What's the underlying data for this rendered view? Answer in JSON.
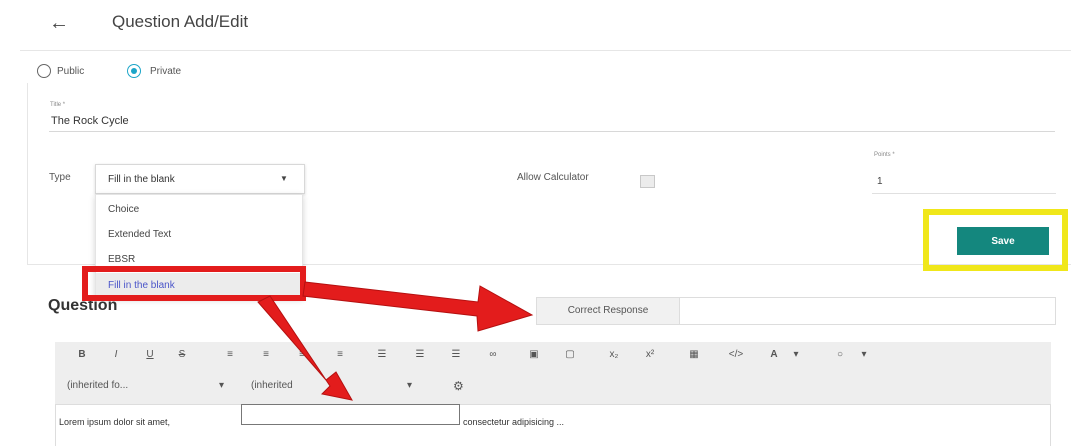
{
  "header": {
    "back_icon": "arrow-left-icon",
    "back_glyph": "←",
    "title": "Question Add/Edit"
  },
  "visibility": {
    "options": [
      "Public",
      "Private"
    ],
    "selected": "Private"
  },
  "form": {
    "title_label": "Title *",
    "title_value": "The Rock Cycle",
    "type_label": "Type",
    "type_value": "Fill in the blank",
    "type_options": [
      "Choice",
      "Extended Text",
      "EBSR",
      "Fill in the blank"
    ],
    "allow_calculator_label": "Allow Calculator",
    "allow_calculator_checked": false,
    "points_label": "Points *",
    "points_value": "1"
  },
  "save_label": "Save",
  "question": {
    "heading": "Question",
    "correct_response_label": "Correct Response",
    "correct_response_value": ""
  },
  "toolbar": {
    "buttons": [
      "B",
      "I",
      "U",
      "S",
      "≡",
      "≡",
      "≡",
      "≡",
      "☰",
      "☰",
      "☰",
      "∞",
      "▣",
      "▢",
      "x₂",
      "x²",
      "▦",
      "</>",
      "A",
      "▾",
      "○",
      "▾"
    ],
    "button_icons": [
      "bold-icon",
      "italic-icon",
      "underline-icon",
      "strikethrough-icon",
      "align-left-icon",
      "align-center-icon",
      "align-right-icon",
      "align-justify-icon",
      "bullet-list-icon",
      "numbered-list-icon",
      "indent-icon",
      "link-icon",
      "image-icon",
      "file-icon",
      "subscript-icon",
      "superscript-icon",
      "table-icon",
      "code-icon",
      "font-color-icon",
      "font-color-caret-icon",
      "highlight-icon",
      "highlight-caret-icon"
    ],
    "font_family": "(inherited fo...",
    "font_size": "(inherited",
    "caret": "▾",
    "settings_icon": "gear-icon",
    "settings_glyph": "⚙"
  },
  "editor": {
    "text_before": "Lorem ipsum dolor sit amet,",
    "blank_value": "",
    "text_after": "consectetur adipisicing ..."
  },
  "colors": {
    "accent": "#1ba5c8",
    "save": "#14877e",
    "highlight_yellow": "#f0e71a",
    "annotation_red": "#e31c1c",
    "selected_item": "#4a55c9"
  }
}
